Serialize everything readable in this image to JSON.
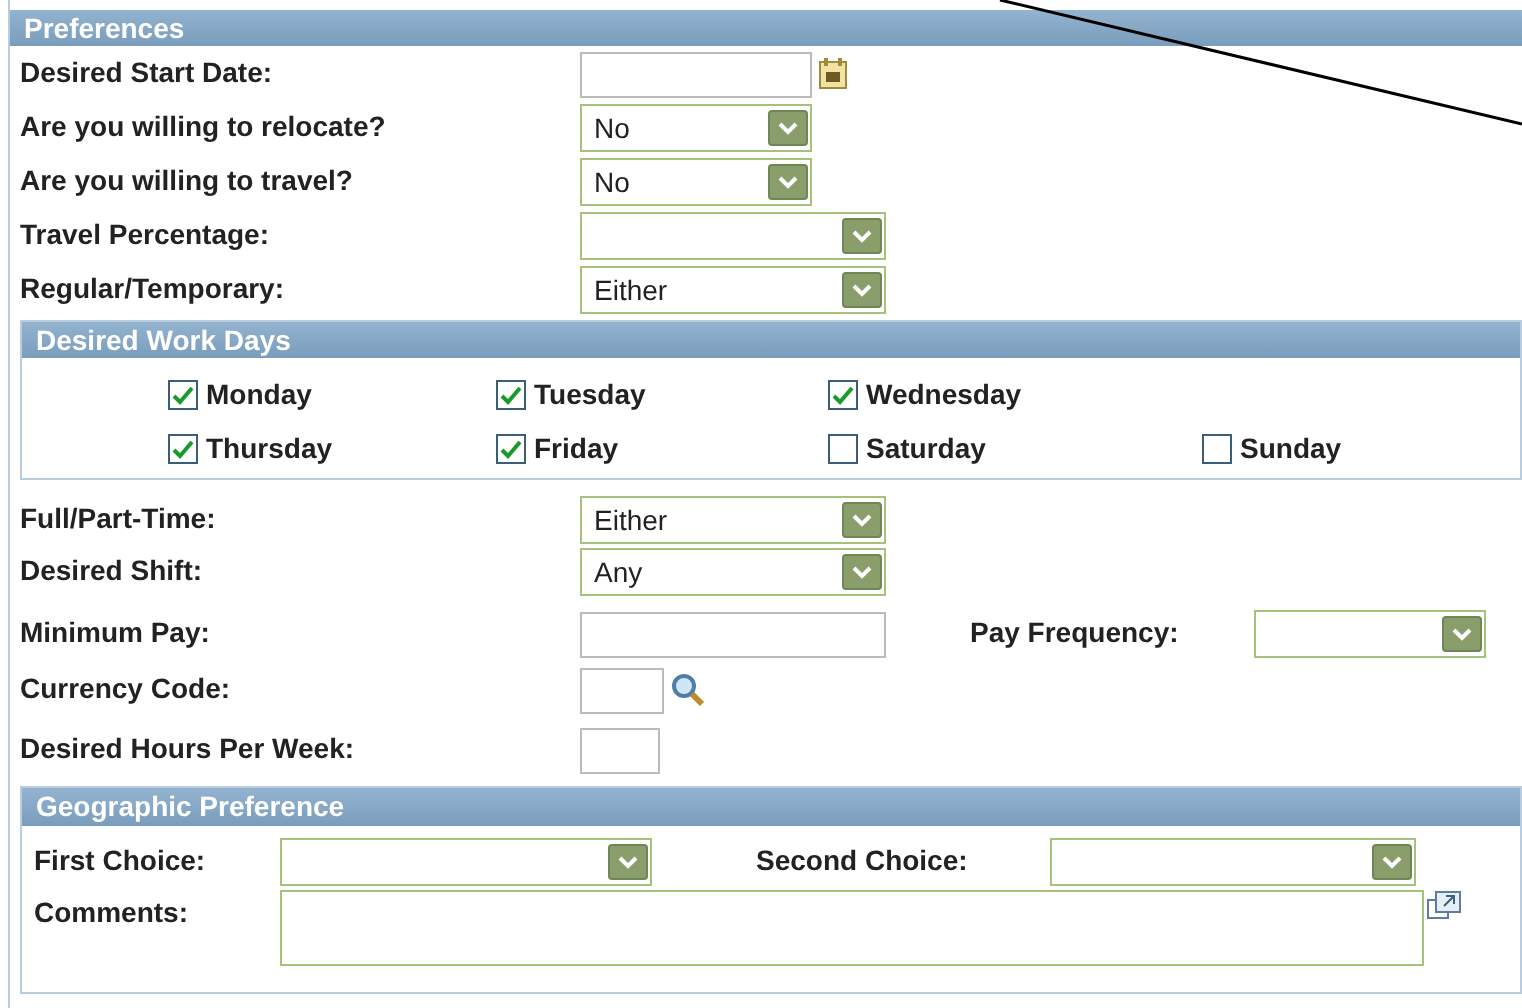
{
  "preferences": {
    "title": "Preferences",
    "fields": [
      {
        "label": "Desired Start Date:",
        "kind": "date"
      },
      {
        "label": "Are you willing to relocate?",
        "kind": "select",
        "value": "No"
      },
      {
        "label": "Are you willing to travel?",
        "kind": "select",
        "value": "No"
      },
      {
        "label": "Travel Percentage:",
        "kind": "select"
      },
      {
        "label": "Regular/Temporary:",
        "kind": "select",
        "value": "Either"
      }
    ]
  },
  "work_days": {
    "title": "Desired Work Days",
    "days": [
      {
        "label": "Monday",
        "checked": true
      },
      {
        "label": "Tuesday",
        "checked": true
      },
      {
        "label": "Wednesday",
        "checked": true
      },
      {
        "label": "Thursday",
        "checked": true
      },
      {
        "label": "Friday",
        "checked": true
      },
      {
        "label": "Saturday",
        "checked": false
      },
      {
        "label": "Sunday",
        "checked": false
      }
    ]
  },
  "more_fields": [
    {
      "label": "Full/Part-Time:",
      "kind": "select",
      "value": "Either"
    },
    {
      "label": "Desired Shift:",
      "kind": "select",
      "value": "Any"
    },
    {
      "label": "Minimum Pay:",
      "kind": "text"
    },
    {
      "label": "Currency Code:",
      "kind": "lookup"
    },
    {
      "label": "Desired Hours Per Week:",
      "kind": "text"
    }
  ],
  "pay_frequency": {
    "label": "Pay Frequency:",
    "kind": "select"
  },
  "geographic": {
    "title": "Geographic Preference",
    "first_choice": {
      "label": "First Choice:",
      "kind": "select"
    },
    "second_choice": {
      "label": "Second Choice:",
      "kind": "select"
    },
    "comments": {
      "label": "Comments:"
    }
  }
}
